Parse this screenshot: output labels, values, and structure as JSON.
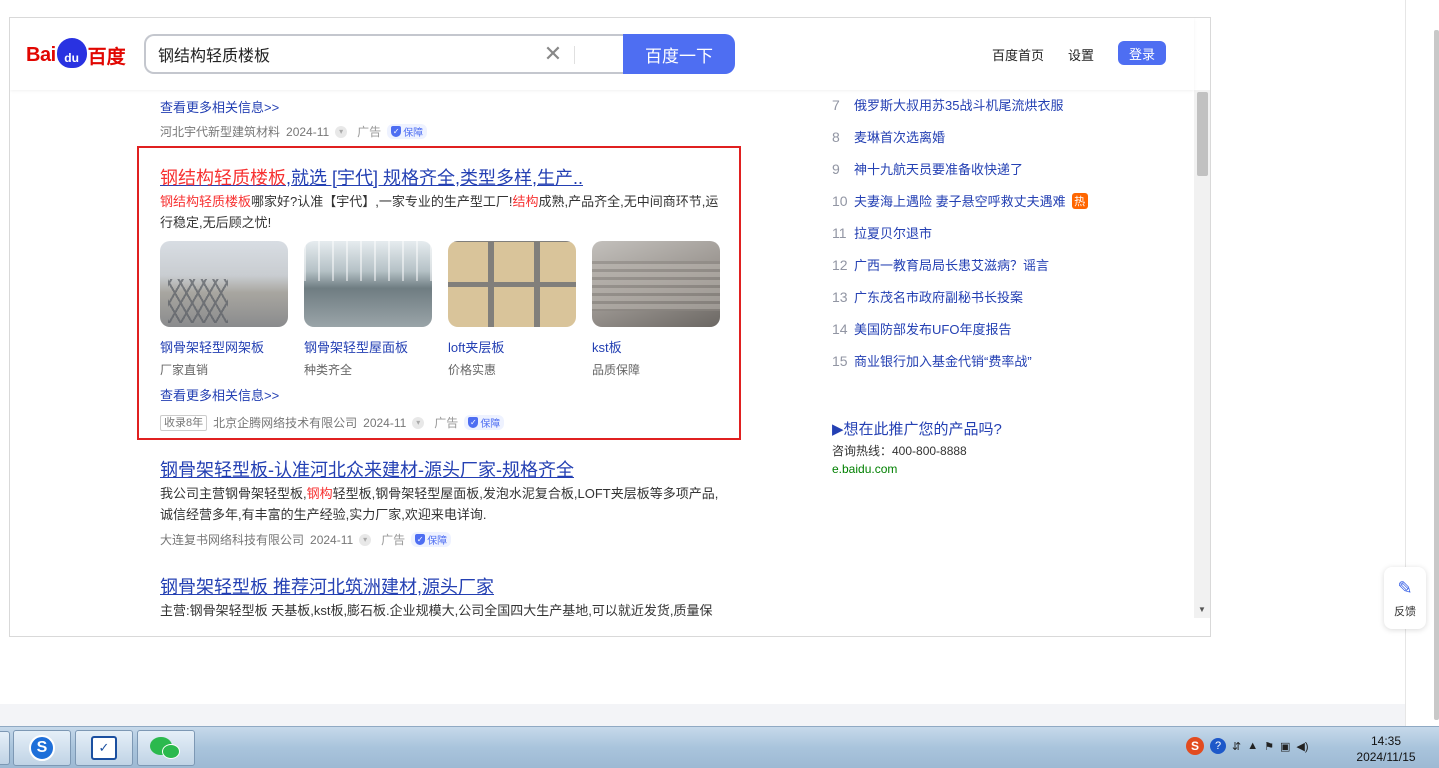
{
  "header": {
    "logo": {
      "bai": "Bai",
      "du": "du",
      "cn": "百度"
    },
    "search_value": "钢结构轻质楼板",
    "search_button": "百度一下",
    "links": {
      "home": "百度首页",
      "settings": "设置",
      "login": "登录"
    }
  },
  "top_fragment": {
    "more_info": "查看更多相关信息>>",
    "company": "河北宇代新型建筑材料",
    "date": "2024-11",
    "ad": "广告",
    "badge": "保障"
  },
  "ad_result": {
    "title_hl": "钢结构轻质楼板",
    "title_rest": ",就选 [宇代] 规格齐全,类型多样,生产..",
    "desc": [
      {
        "text": "钢结构轻质楼板",
        "hl": true
      },
      {
        "text": "哪家好?认准【宇代】,一家专业的生产型工厂!",
        "hl": false
      },
      {
        "text": "结构",
        "hl": true
      },
      {
        "text": "成熟,产品齐全,无中间商环节,运行稳定,无后顾之忧!",
        "hl": false
      }
    ],
    "thumbs": [
      {
        "name": "钢骨架轻型网架板",
        "sub": "厂家直销",
        "icon": "steel-frame-mesh-panel-image"
      },
      {
        "name": "钢骨架轻型屋面板",
        "sub": "种类齐全",
        "icon": "factory-roof-panel-image"
      },
      {
        "name": "loft夹层板",
        "sub": "价格实惠",
        "icon": "loft-floor-panel-image"
      },
      {
        "name": "kst板",
        "sub": "品质保障",
        "icon": "kst-panel-stack-image"
      }
    ],
    "more_info": "查看更多相关信息>>",
    "record": "收录8年",
    "company": "北京企腾网络技术有限公司",
    "date": "2024-11",
    "ad": "广告",
    "badge": "保障",
    "border_color": "#e02020"
  },
  "result2": {
    "title": "钢骨架轻型板-认准河北众来建材-源头厂家-规格齐全",
    "desc": [
      {
        "text": "我公司主营钢骨架轻型板,",
        "hl": false
      },
      {
        "text": "钢构",
        "hl": true
      },
      {
        "text": "轻型板,钢骨架轻型屋面板,发泡水泥复合板,LOFT夹层板等多项产品,诚信经营多年,有丰富的生产经验,实力厂家,欢迎来电详询.",
        "hl": false
      }
    ],
    "company": "大连复书网络科技有限公司",
    "date": "2024-11",
    "ad": "广告",
    "badge": "保障"
  },
  "result3": {
    "title": "钢骨架轻型板 推荐河北筑洲建材,源头厂家",
    "desc": "主营:钢骨架轻型板 天基板,kst板,膨石板.企业规模大,公司全国四大生产基地,可以就近发货,质量保"
  },
  "hot_list": [
    {
      "num": "7",
      "text": "俄罗斯大叔用苏35战斗机尾流烘衣服",
      "hot": false
    },
    {
      "num": "8",
      "text": "麦琳首次选离婚",
      "hot": false
    },
    {
      "num": "9",
      "text": "神十九航天员要准备收快递了",
      "hot": false
    },
    {
      "num": "10",
      "text": "夫妻海上遇险 妻子悬空呼救丈夫遇难",
      "hot": true,
      "tag": "热"
    },
    {
      "num": "11",
      "text": "拉夏贝尔退市",
      "hot": false
    },
    {
      "num": "12",
      "text": "广西一教育局局长患艾滋病？谣言",
      "hot": false
    },
    {
      "num": "13",
      "text": "广东茂名市政府副秘书长投案",
      "hot": false
    },
    {
      "num": "14",
      "text": "美国防部发布UFO年度报告",
      "hot": false
    },
    {
      "num": "15",
      "text": "商业银行加入基金代销“费率战”",
      "hot": false
    }
  ],
  "promo": {
    "title": "▶想在此推广您的产品吗?",
    "phone": "咨询热线：400-800-8888",
    "url": "e.baidu.com"
  },
  "feedback": {
    "label": "反馈",
    "icon": "pen-edit-icon"
  },
  "taskbar": {
    "apps": [
      {
        "name": "sogou-browser",
        "glyph": "S"
      },
      {
        "name": "security-guard",
        "glyph": "✓"
      },
      {
        "name": "wechat",
        "glyph": ""
      }
    ],
    "tray_s": "S",
    "tray_q": "?",
    "time": "14:35",
    "date": "2024/11/15"
  },
  "colors": {
    "baidu_blue": "#4e6ef2",
    "link_blue": "#2440b3",
    "highlight_red": "#f73131",
    "hot_orange": "#ff6600"
  }
}
